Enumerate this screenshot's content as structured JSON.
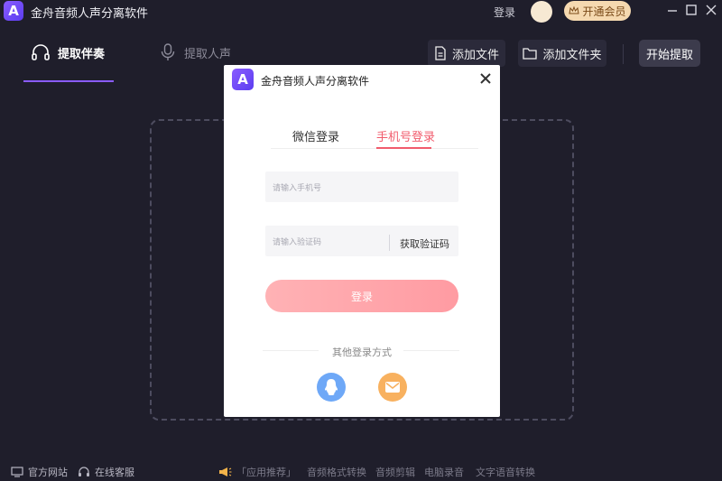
{
  "app": {
    "logo_letter": "A",
    "title": "金舟音频人声分离软件",
    "login_link": "登录",
    "vip_button": "开通会员",
    "window_controls": [
      "minimize-icon",
      "maximize-icon",
      "close-icon"
    ]
  },
  "tabs": [
    {
      "label": "提取伴奏",
      "icon": "headphones-icon",
      "active": true
    },
    {
      "label": "提取人声",
      "icon": "microphone-icon",
      "active": false
    }
  ],
  "toolbar": {
    "add_file": "添加文件",
    "add_folder": "添加文件夹",
    "start": "开始提取"
  },
  "footer": {
    "official_site": "官方网站",
    "online_service": "在线客服",
    "recommend": "「应用推荐」",
    "links": [
      "音频格式转换",
      "音频剪辑",
      "电脑录音",
      "文字语音转换"
    ]
  },
  "modal": {
    "logo_letter": "A",
    "title": "金舟音频人声分离软件",
    "tab_wechat": "微信登录",
    "tab_phone": "手机号登录",
    "phone_placeholder": "请输入手机号",
    "code_placeholder": "请输入验证码",
    "get_code": "获取验证码",
    "login_button": "登录",
    "other_methods": "其他登录方式"
  },
  "colors": {
    "background": "#1f1e2b",
    "accent": "#8a5cff",
    "modal_accent": "#f15b6c",
    "login_button": "#ffa6ab",
    "vip": "#f5d9b0",
    "qq": "#6ea8f7",
    "mail": "#f8b15f"
  }
}
